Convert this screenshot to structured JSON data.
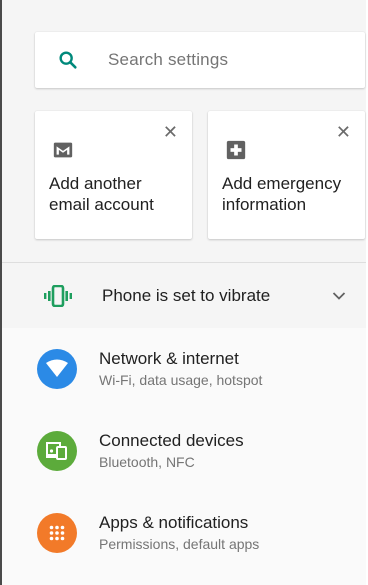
{
  "search": {
    "placeholder": "Search settings",
    "icon": "search-icon",
    "icon_color": "#00897b"
  },
  "suggestions": [
    {
      "icon": "gmail-icon",
      "label": "Add another email account",
      "close": "✕"
    },
    {
      "icon": "medical-plus-icon",
      "label": "Add emergency information",
      "close": "✕"
    }
  ],
  "condition": {
    "icon": "vibrate-icon",
    "label": "Phone is set to vibrate",
    "icon_color": "#1e9e5e"
  },
  "settings": [
    {
      "title": "Network & internet",
      "subtitle": "Wi-Fi, data usage, hotspot",
      "icon": "wifi-icon",
      "color": "#2b8ae6"
    },
    {
      "title": "Connected devices",
      "subtitle": "Bluetooth, NFC",
      "icon": "devices-icon",
      "color": "#5cab3b"
    },
    {
      "title": "Apps & notifications",
      "subtitle": "Permissions, default apps",
      "icon": "apps-grid-icon",
      "color": "#f27a29"
    }
  ]
}
